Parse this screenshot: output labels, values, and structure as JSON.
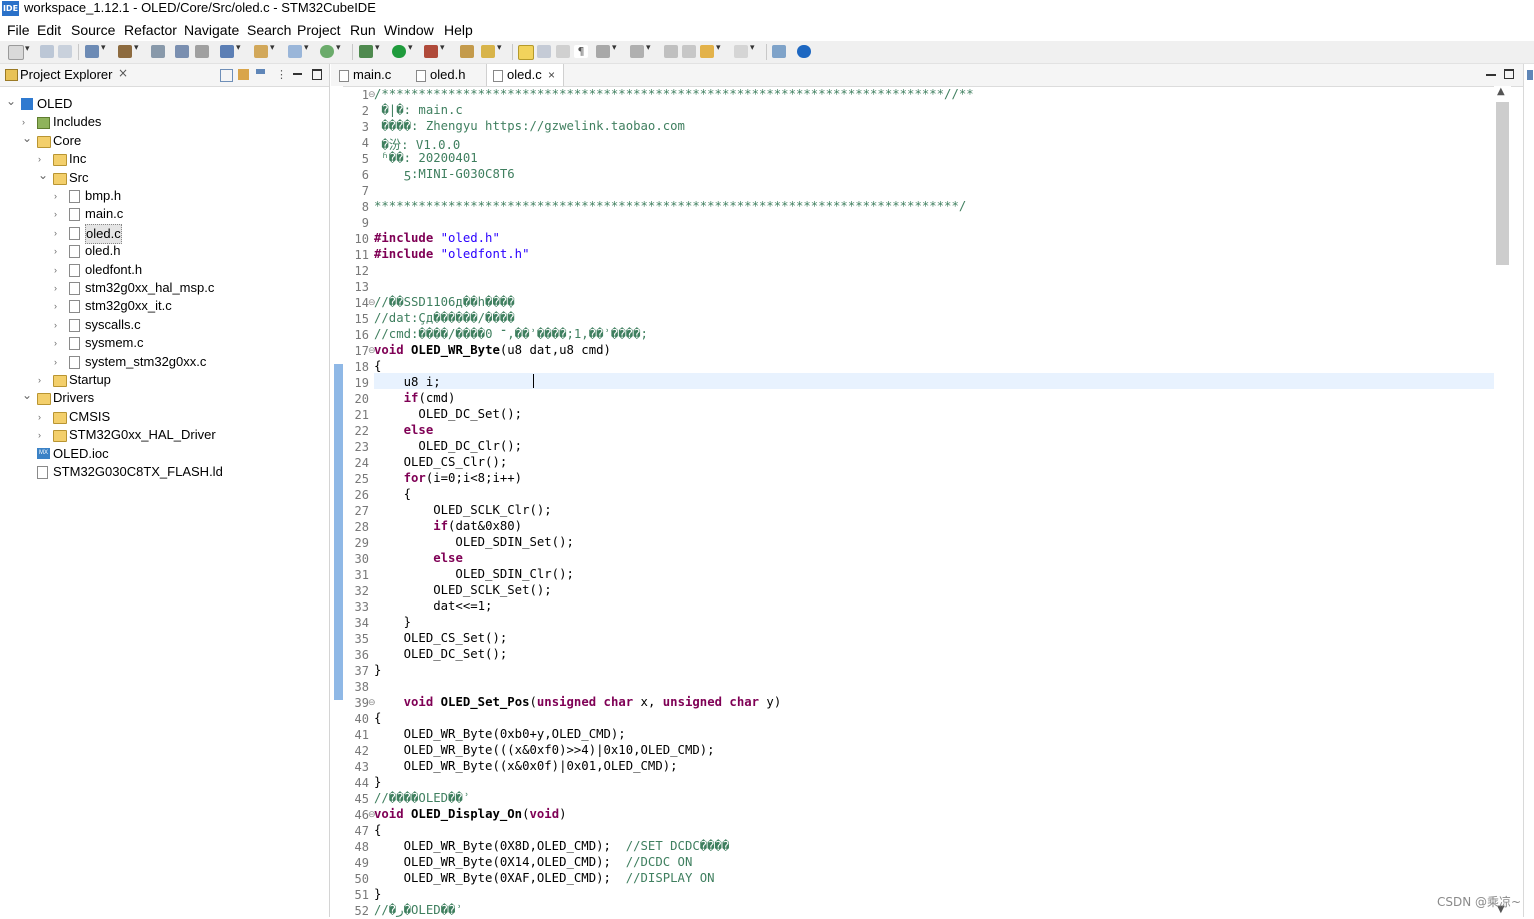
{
  "window": {
    "title": "workspace_1.12.1 - OLED/Core/Src/oled.c - STM32CubeIDE",
    "app_icon_text": "IDE"
  },
  "menu": [
    "File",
    "Edit",
    "Source",
    "Refactor",
    "Navigate",
    "Search",
    "Project",
    "Run",
    "Window",
    "Help"
  ],
  "explorer": {
    "title": "Project Explorer",
    "close_glyph": "×",
    "tree": [
      {
        "label": "OLED",
        "depth": 0,
        "icon": "project-icon",
        "expanded": true
      },
      {
        "label": "Includes",
        "depth": 1,
        "icon": "includes-icon",
        "expanded": false
      },
      {
        "label": "Core",
        "depth": 1,
        "icon": "folder-icon",
        "expanded": true
      },
      {
        "label": "Inc",
        "depth": 2,
        "icon": "folder-icon",
        "expanded": false
      },
      {
        "label": "Src",
        "depth": 2,
        "icon": "folder-icon",
        "expanded": true
      },
      {
        "label": "bmp.h",
        "depth": 3,
        "icon": "header-file-icon",
        "expanded": false
      },
      {
        "label": "main.c",
        "depth": 3,
        "icon": "c-file-icon",
        "expanded": false
      },
      {
        "label": "oled.c",
        "depth": 3,
        "icon": "c-file-icon",
        "expanded": false,
        "selected": true
      },
      {
        "label": "oled.h",
        "depth": 3,
        "icon": "header-file-icon",
        "expanded": false
      },
      {
        "label": "oledfont.h",
        "depth": 3,
        "icon": "header-file-icon",
        "expanded": false
      },
      {
        "label": "stm32g0xx_hal_msp.c",
        "depth": 3,
        "icon": "c-file-icon",
        "expanded": false
      },
      {
        "label": "stm32g0xx_it.c",
        "depth": 3,
        "icon": "c-file-icon",
        "expanded": false
      },
      {
        "label": "syscalls.c",
        "depth": 3,
        "icon": "c-file-icon",
        "expanded": false
      },
      {
        "label": "sysmem.c",
        "depth": 3,
        "icon": "c-file-icon",
        "expanded": false
      },
      {
        "label": "system_stm32g0xx.c",
        "depth": 3,
        "icon": "c-file-icon",
        "expanded": false
      },
      {
        "label": "Startup",
        "depth": 2,
        "icon": "folder-icon",
        "expanded": false
      },
      {
        "label": "Drivers",
        "depth": 1,
        "icon": "folder-icon",
        "expanded": true
      },
      {
        "label": "CMSIS",
        "depth": 2,
        "icon": "folder-icon",
        "expanded": false
      },
      {
        "label": "STM32G0xx_HAL_Driver",
        "depth": 2,
        "icon": "folder-icon",
        "expanded": false
      },
      {
        "label": "OLED.ioc",
        "depth": 1,
        "icon": "ioc-file-icon",
        "leaf": true
      },
      {
        "label": "STM32G030C8TX_FLASH.ld",
        "depth": 1,
        "icon": "ld-file-icon",
        "leaf": true
      }
    ]
  },
  "editor": {
    "tabs": [
      {
        "label": "main.c",
        "active": false
      },
      {
        "label": "oled.h",
        "active": false
      },
      {
        "label": "oled.c",
        "active": true
      }
    ],
    "tab_close_glyph": "×",
    "current_line": 19,
    "fold_marker": "⊖",
    "lines": [
      {
        "n": 1,
        "fold": true,
        "t": [
          [
            "cmt",
            "/****************************************************************************//**"
          ]
        ]
      },
      {
        "n": 2,
        "t": [
          [
            "cmt",
            " �|�: main.c"
          ]
        ]
      },
      {
        "n": 3,
        "t": [
          [
            "cmt",
            " ����: Zhengyu https://gzwelink.taobao.com"
          ]
        ]
      },
      {
        "n": 4,
        "t": [
          [
            "cmt",
            " �汾: V1.0.0"
          ]
        ]
      },
      {
        "n": 5,
        "t": [
          [
            "cmt",
            " ʱ��: 20200401"
          ]
        ]
      },
      {
        "n": 6,
        "t": [
          [
            "cmt",
            "    ƽ:MINI-G030C8T6"
          ]
        ]
      },
      {
        "n": 7,
        "t": [
          [
            "",
            ""
          ]
        ]
      },
      {
        "n": 8,
        "t": [
          [
            "cmt",
            "*******************************************************************************/"
          ]
        ]
      },
      {
        "n": 9,
        "t": [
          [
            "",
            ""
          ]
        ]
      },
      {
        "n": 10,
        "t": [
          [
            "kw",
            "#include"
          ],
          [
            "",
            " "
          ],
          [
            "str",
            "\"oled.h\""
          ]
        ]
      },
      {
        "n": 11,
        "t": [
          [
            "kw",
            "#include"
          ],
          [
            "",
            " "
          ],
          [
            "str",
            "\"oledfont.h\""
          ]
        ]
      },
      {
        "n": 12,
        "t": [
          [
            "",
            ""
          ]
        ]
      },
      {
        "n": 13,
        "t": [
          [
            "",
            ""
          ]
        ]
      },
      {
        "n": 14,
        "fold": true,
        "t": [
          [
            "cmt",
            "//��SSD1106д��һ���ֽ�"
          ]
        ]
      },
      {
        "n": 15,
        "t": [
          [
            "cmt",
            "//dat:Ҫд������/����"
          ]
        ]
      },
      {
        "n": 16,
        "t": [
          [
            "cmt",
            "//cmd:����/����־ 0,��ʾ����;1,��ʾ����;"
          ]
        ]
      },
      {
        "n": 17,
        "fold": true,
        "t": [
          [
            "kw",
            "void"
          ],
          [
            "",
            " "
          ],
          [
            "fn",
            "OLED_WR_Byte"
          ],
          [
            "",
            "(u8 dat,u8 cmd)"
          ]
        ]
      },
      {
        "n": 18,
        "t": [
          [
            "",
            "{"
          ]
        ]
      },
      {
        "n": 19,
        "t": [
          [
            "",
            "    u8 i;"
          ]
        ]
      },
      {
        "n": 20,
        "t": [
          [
            "",
            "    "
          ],
          [
            "kw",
            "if"
          ],
          [
            "",
            "(cmd)"
          ]
        ]
      },
      {
        "n": 21,
        "t": [
          [
            "",
            "      OLED_DC_Set();"
          ]
        ]
      },
      {
        "n": 22,
        "t": [
          [
            "",
            "    "
          ],
          [
            "kw",
            "else"
          ]
        ]
      },
      {
        "n": 23,
        "t": [
          [
            "",
            "      OLED_DC_Clr();"
          ]
        ]
      },
      {
        "n": 24,
        "t": [
          [
            "",
            "    OLED_CS_Clr();"
          ]
        ]
      },
      {
        "n": 25,
        "t": [
          [
            "",
            "    "
          ],
          [
            "kw",
            "for"
          ],
          [
            "",
            "(i=0;i<8;i++)"
          ]
        ]
      },
      {
        "n": 26,
        "t": [
          [
            "",
            "    {"
          ]
        ]
      },
      {
        "n": 27,
        "t": [
          [
            "",
            "        OLED_SCLK_Clr();"
          ]
        ]
      },
      {
        "n": 28,
        "t": [
          [
            "",
            "        "
          ],
          [
            "kw",
            "if"
          ],
          [
            "",
            "(dat&0x80)"
          ]
        ]
      },
      {
        "n": 29,
        "t": [
          [
            "",
            "           OLED_SDIN_Set();"
          ]
        ]
      },
      {
        "n": 30,
        "t": [
          [
            "",
            "        "
          ],
          [
            "kw",
            "else"
          ]
        ]
      },
      {
        "n": 31,
        "t": [
          [
            "",
            "           OLED_SDIN_Clr();"
          ]
        ]
      },
      {
        "n": 32,
        "t": [
          [
            "",
            "        OLED_SCLK_Set();"
          ]
        ]
      },
      {
        "n": 33,
        "t": [
          [
            "",
            "        dat<<=1;"
          ]
        ]
      },
      {
        "n": 34,
        "t": [
          [
            "",
            "    }"
          ]
        ]
      },
      {
        "n": 35,
        "t": [
          [
            "",
            "    OLED_CS_Set();"
          ]
        ]
      },
      {
        "n": 36,
        "t": [
          [
            "",
            "    OLED_DC_Set();"
          ]
        ]
      },
      {
        "n": 37,
        "t": [
          [
            "",
            "}"
          ]
        ]
      },
      {
        "n": 38,
        "t": [
          [
            "",
            ""
          ]
        ]
      },
      {
        "n": 39,
        "fold": true,
        "t": [
          [
            "",
            "    "
          ],
          [
            "kw",
            "void"
          ],
          [
            "",
            " "
          ],
          [
            "fn",
            "OLED_Set_Pos"
          ],
          [
            "",
            "("
          ],
          [
            "kw",
            "unsigned char"
          ],
          [
            "",
            " x, "
          ],
          [
            "kw",
            "unsigned char"
          ],
          [
            "",
            " y)"
          ]
        ]
      },
      {
        "n": 40,
        "t": [
          [
            "",
            "{"
          ]
        ]
      },
      {
        "n": 41,
        "t": [
          [
            "",
            "    OLED_WR_Byte(0xb0+y,OLED_CMD);"
          ]
        ]
      },
      {
        "n": 42,
        "t": [
          [
            "",
            "    OLED_WR_Byte(((x&0xf0)>>4)|0x10,OLED_CMD);"
          ]
        ]
      },
      {
        "n": 43,
        "t": [
          [
            "",
            "    OLED_WR_Byte((x&0x0f)|0x01,OLED_CMD);"
          ]
        ]
      },
      {
        "n": 44,
        "t": [
          [
            "",
            "}"
          ]
        ]
      },
      {
        "n": 45,
        "t": [
          [
            "cmt",
            "//����OLED��ʾ"
          ]
        ]
      },
      {
        "n": 46,
        "fold": true,
        "t": [
          [
            "kw",
            "void"
          ],
          [
            "",
            " "
          ],
          [
            "fn",
            "OLED_Display_On"
          ],
          [
            "",
            "("
          ],
          [
            "kw",
            "void"
          ],
          [
            "",
            ")"
          ]
        ]
      },
      {
        "n": 47,
        "t": [
          [
            "",
            "{"
          ]
        ]
      },
      {
        "n": 48,
        "t": [
          [
            "",
            "    OLED_WR_Byte(0X8D,OLED_CMD);  "
          ],
          [
            "cmt",
            "//SET DCDC����"
          ]
        ]
      },
      {
        "n": 49,
        "t": [
          [
            "",
            "    OLED_WR_Byte(0X14,OLED_CMD);  "
          ],
          [
            "cmt",
            "//DCDC ON"
          ]
        ]
      },
      {
        "n": 50,
        "t": [
          [
            "",
            "    OLED_WR_Byte(0XAF,OLED_CMD);  "
          ],
          [
            "cmt",
            "//DISPLAY ON"
          ]
        ]
      },
      {
        "n": 51,
        "t": [
          [
            "",
            "}"
          ]
        ]
      },
      {
        "n": 52,
        "t": [
          [
            "cmt",
            "//�ر�OLED��ʾ"
          ]
        ]
      }
    ]
  },
  "watermark": "CSDN @乘凉~",
  "colors": {
    "comment": "#3f7f5f",
    "keyword": "#7f0055",
    "string": "#2a00ff",
    "current_line": "#e8f2fe",
    "ruler_mark": "#8fb8e6"
  }
}
